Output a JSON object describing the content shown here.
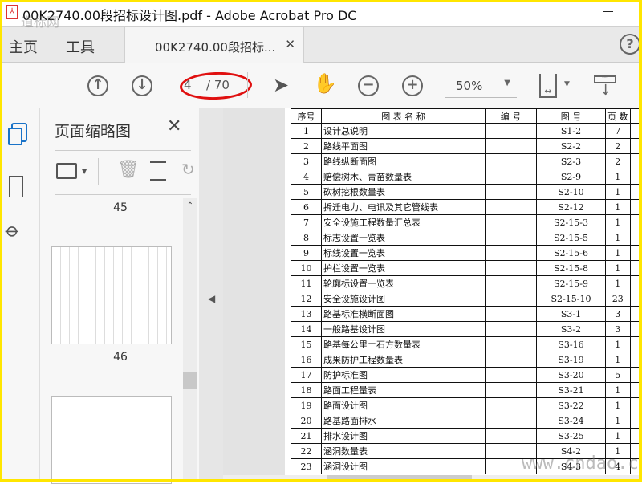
{
  "window": {
    "title": "00K2740.00段招标设计图.pdf - Adobe Acrobat Pro DC",
    "watermark_top": "道标网",
    "watermark_bottom": "www.cndao.com"
  },
  "tabs": {
    "home": "主页",
    "tools": "工具",
    "document": "00K2740.00段招标...",
    "help": "?"
  },
  "toolbar": {
    "current_page": "4",
    "total_pages": "/ 70",
    "zoom": "50%"
  },
  "panel": {
    "title": "页面缩略图",
    "pages": [
      "45",
      "46"
    ]
  },
  "table": {
    "headers": [
      "序号",
      "图 表 名 称",
      "编 号",
      "图 号",
      "页 数"
    ],
    "rows": [
      [
        "1",
        "设计总说明",
        "",
        "S1-2",
        "7"
      ],
      [
        "2",
        "路线平面图",
        "",
        "S2-2",
        "2"
      ],
      [
        "3",
        "路线纵断面图",
        "",
        "S2-3",
        "2"
      ],
      [
        "4",
        "赔偿树木、青苗数量表",
        "",
        "S2-9",
        "1"
      ],
      [
        "5",
        " 砍树挖根数量表",
        "",
        "S2-10",
        "1"
      ],
      [
        "6",
        "拆迁电力、电讯及其它管线表",
        "",
        "S2-12",
        "1"
      ],
      [
        "7",
        "安全设施工程数量汇总表",
        "",
        "S2-15-3",
        "1"
      ],
      [
        "8",
        "标志设置一览表",
        "",
        "S2-15-5",
        "1"
      ],
      [
        "9",
        "标线设置一览表",
        "",
        "S2-15-6",
        "1"
      ],
      [
        "10",
        "护栏设置一览表",
        "",
        "S2-15-8",
        "1"
      ],
      [
        "11",
        "轮廓标设置一览表",
        "",
        "S2-15-9",
        "1"
      ],
      [
        "12",
        "安全设施设计图",
        "",
        "S2-15-10",
        "23"
      ],
      [
        "13",
        "路基标准横断面图",
        "",
        "S3-1",
        "3"
      ],
      [
        "14",
        "一般路基设计图",
        "",
        "S3-2",
        "3"
      ],
      [
        "15",
        "路基每公里土石方数量表",
        "",
        "S3-16",
        "1"
      ],
      [
        "16",
        "成果防护工程数量表",
        "",
        "S3-19",
        "1"
      ],
      [
        "17",
        "防护标准图",
        "",
        "S3-20",
        "5"
      ],
      [
        "18",
        "路面工程量表",
        "",
        "S3-21",
        "1"
      ],
      [
        "19",
        "路面设计图",
        "",
        "S3-22",
        "1"
      ],
      [
        "20",
        "路基路面排水",
        "",
        "S3-24",
        "1"
      ],
      [
        "21",
        "排水设计图",
        "",
        "S3-25",
        "1"
      ],
      [
        "22",
        "涵洞数量表",
        "",
        "S4-2",
        "1"
      ],
      [
        "23",
        "涵洞设计图",
        "",
        "S4-3",
        "4"
      ]
    ]
  },
  "colors": {
    "accent": "#1a73c8",
    "annotation": "#e01010",
    "border": "#ffe600"
  }
}
